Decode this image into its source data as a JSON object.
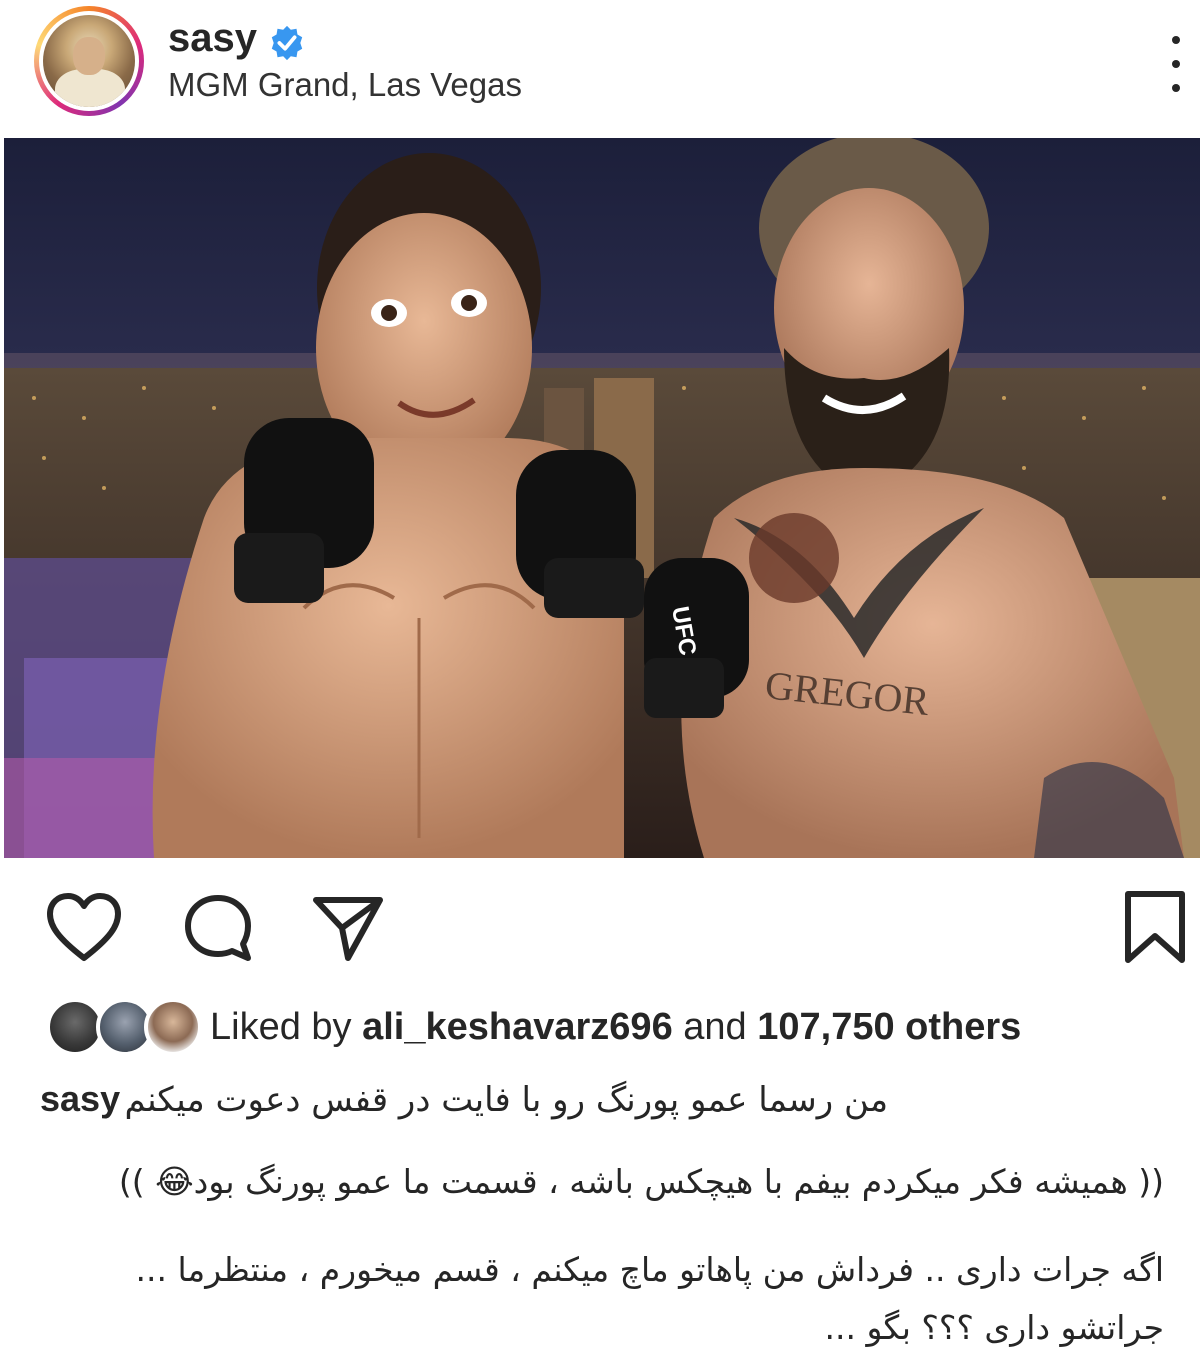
{
  "header": {
    "username": "sasy",
    "location": "MGM Grand, Las Vegas",
    "verified": true
  },
  "post_image": {
    "glove_text": "UFC",
    "tattoo_text": "GREGOR"
  },
  "actions": {
    "like_icon": "heart-icon",
    "comment_icon": "comment-icon",
    "share_icon": "paper-plane-icon",
    "save_icon": "bookmark-icon"
  },
  "likes": {
    "prefix": "Liked by",
    "user": "ali_keshavarz696",
    "middle": "and",
    "others": "107,750 others"
  },
  "caption": {
    "username": "sasy",
    "line0": "من رسما عمو پورنگ رو با فایت در قفس دعوت میکنم",
    "line1": "(( همیشه فکر میکردم بیفم با هیچکس باشه ، قسمت ما عمو پورنگ بود😂 ))",
    "line2": "اگه جرات داری .. فرداش من پاهاتو ماچ میکنم ، قسم میخورم ، منتظرما ...",
    "line3": "جراتشو داری ؟؟؟ بگو ..."
  },
  "colors": {
    "verified_blue": "#3897f0",
    "text": "#262626"
  }
}
